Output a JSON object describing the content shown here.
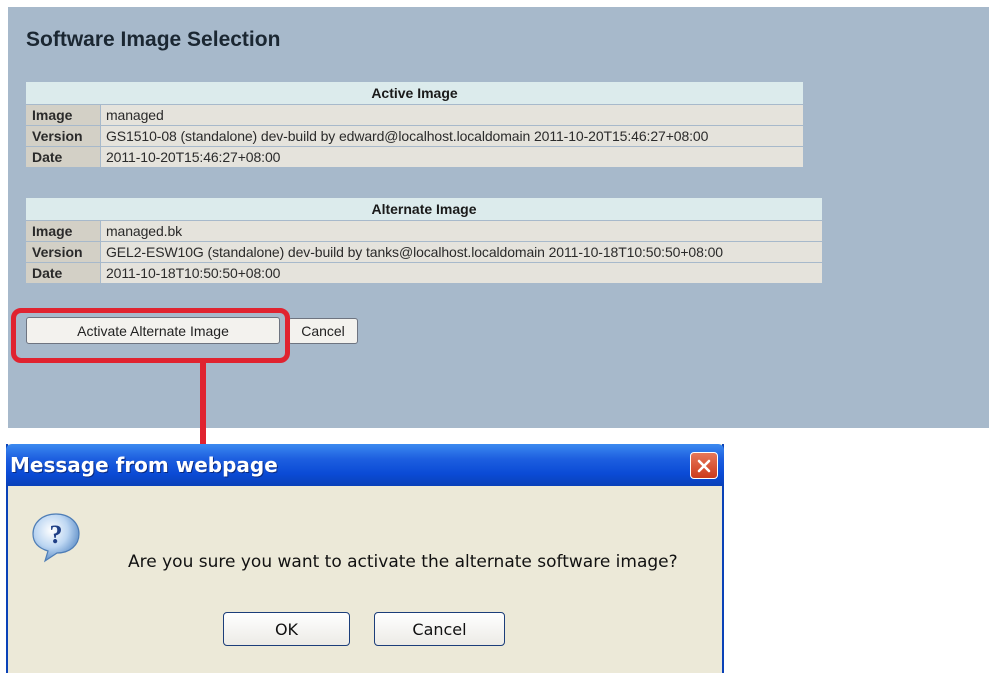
{
  "page": {
    "title": "Software Image Selection",
    "active": {
      "caption": "Active Image",
      "rows": [
        {
          "label": "Image",
          "value": "managed"
        },
        {
          "label": "Version",
          "value": "GS1510-08 (standalone) dev-build by edward@localhost.localdomain 2011-10-20T15:46:27+08:00"
        },
        {
          "label": "Date",
          "value": "2011-10-20T15:46:27+08:00"
        }
      ]
    },
    "alternate": {
      "caption": "Alternate Image",
      "rows": [
        {
          "label": "Image",
          "value": "managed.bk"
        },
        {
          "label": "Version",
          "value": "GEL2-ESW10G (standalone) dev-build by tanks@localhost.localdomain 2011-10-18T10:50:50+08:00"
        },
        {
          "label": "Date",
          "value": "2011-10-18T10:50:50+08:00"
        }
      ]
    },
    "buttons": {
      "activate": "Activate Alternate Image",
      "cancel": "Cancel"
    }
  },
  "dialog": {
    "title": "Message from webpage",
    "message": "Are you sure you want to activate the alternate software image?",
    "ok": "OK",
    "cancel": "Cancel",
    "icon": "question-icon",
    "close_icon": "close-icon"
  },
  "colors": {
    "panel_bg": "#a7b9cb",
    "caption_bg": "#dcebec",
    "label_bg": "#d3d0c6",
    "value_bg": "#e5e3dc",
    "highlight": "#e02330",
    "titlebar": "#0b4bd6"
  }
}
